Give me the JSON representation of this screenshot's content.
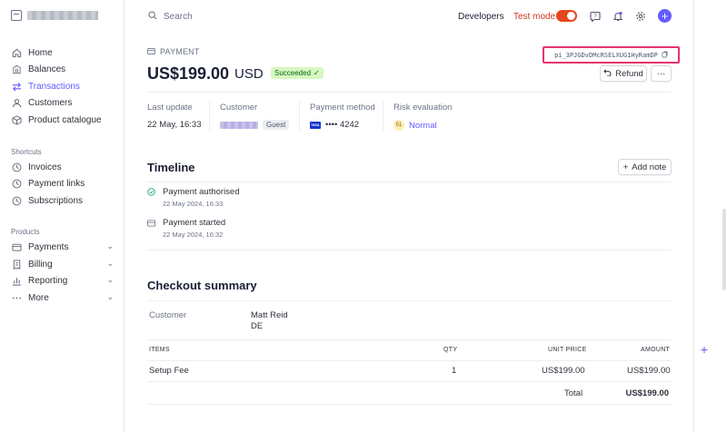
{
  "sidebar": {
    "nav": [
      {
        "label": "Home",
        "icon": "home-icon"
      },
      {
        "label": "Balances",
        "icon": "bank-icon"
      },
      {
        "label": "Transactions",
        "icon": "arrows-icon",
        "active": true
      },
      {
        "label": "Customers",
        "icon": "person-icon"
      },
      {
        "label": "Product catalogue",
        "icon": "box-icon"
      }
    ],
    "shortcuts_label": "Shortcuts",
    "shortcuts": [
      {
        "label": "Invoices",
        "icon": "clock-icon"
      },
      {
        "label": "Payment links",
        "icon": "clock-icon"
      },
      {
        "label": "Subscriptions",
        "icon": "clock-icon"
      }
    ],
    "products_label": "Products",
    "products": [
      {
        "label": "Payments",
        "icon": "wallet-icon"
      },
      {
        "label": "Billing",
        "icon": "billing-icon"
      },
      {
        "label": "Reporting",
        "icon": "chart-icon"
      },
      {
        "label": "More",
        "icon": "dots-icon"
      }
    ]
  },
  "topbar": {
    "search_placeholder": "Search",
    "developers": "Developers",
    "test_mode": "Test mode"
  },
  "payment": {
    "eyebrow": "PAYMENT",
    "amount": "US$199.00",
    "currency": "USD",
    "status": "Succeeded",
    "id": "pi_3PJGDvDMcRSELXUG1HyRamDP",
    "refund_label": "Refund",
    "more_label": "···"
  },
  "meta": {
    "last_update_label": "Last update",
    "last_update_value": "22 May, 16:33",
    "customer_label": "Customer",
    "customer_tag": "Guest",
    "payment_method_label": "Payment method",
    "card_brand": "VISA",
    "card_last4": "•••• 4242",
    "risk_label": "Risk evaluation",
    "risk_score": "51",
    "risk_level": "Normal"
  },
  "timeline": {
    "title": "Timeline",
    "add_note_label": "Add note",
    "events": [
      {
        "title": "Payment authorised",
        "date": "22 May 2024, 16:33"
      },
      {
        "title": "Payment started",
        "date": "22 May 2024, 16:32"
      }
    ]
  },
  "checkout": {
    "title": "Checkout summary",
    "customer_label": "Customer",
    "customer_name": "Matt Reid",
    "customer_country": "DE",
    "columns": [
      "ITEMS",
      "QTY",
      "UNIT PRICE",
      "AMOUNT"
    ],
    "rows": [
      {
        "item": "Setup Fee",
        "qty": "1",
        "unit_price": "US$199.00",
        "amount": "US$199.00"
      }
    ],
    "total_label": "Total",
    "total_value": "US$199.00"
  },
  "colors": {
    "accent": "#635bff",
    "test_mode": "#e5461e",
    "success_bg": "#d7f7c2",
    "highlight_border": "#e8326e"
  }
}
